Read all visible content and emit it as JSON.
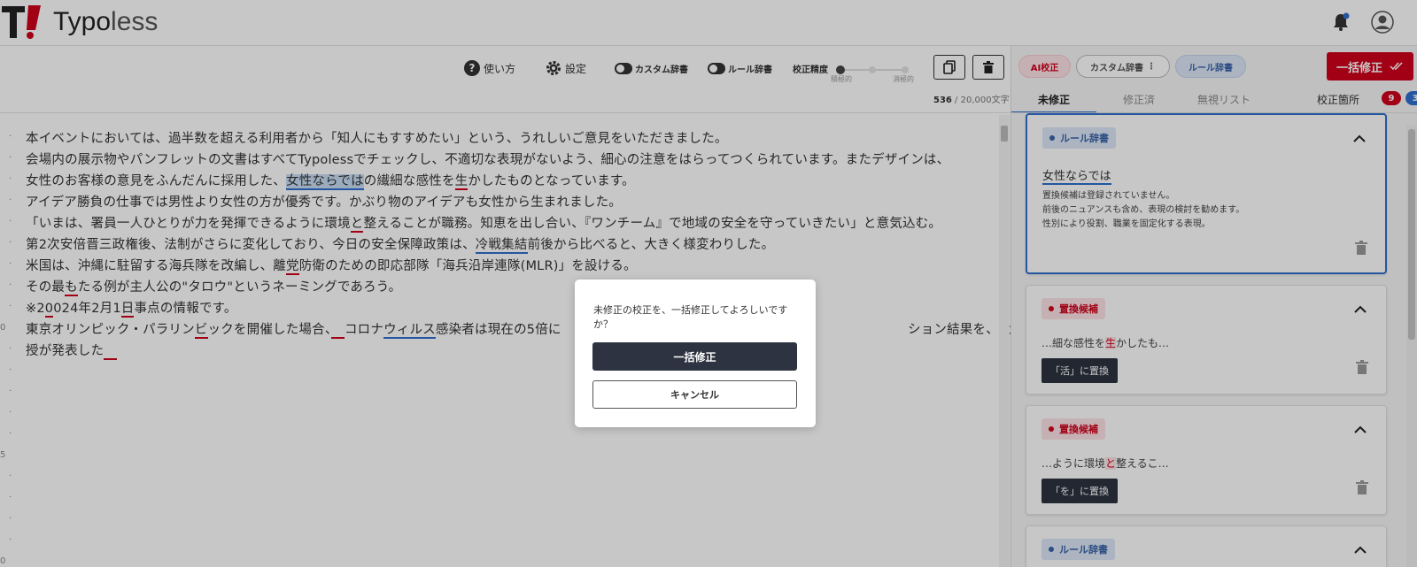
{
  "app": {
    "name_main": "Typo",
    "name_sub": "less"
  },
  "toolbar": {
    "help_label": "使い方",
    "settings_label": "設定",
    "custom_dict_label": "カスタム辞書",
    "rule_dict_label": "ルール辞書",
    "accuracy_label": "校正精度",
    "accuracy_left": "積極的",
    "accuracy_right": "消極的",
    "char_count": "536",
    "char_total": " / 20,000文字"
  },
  "editor": {
    "gutter": [
      "·",
      "·",
      "·",
      "·",
      "·",
      "·",
      "·",
      "·",
      "·",
      "0",
      "·",
      "·",
      "·",
      "·",
      "·",
      "5",
      "·",
      "·",
      "·",
      "·",
      "0"
    ],
    "lines": [
      {
        "segments": [
          {
            "t": "本イベントにおいては、過半数を超える利用者から「知人にもすすめたい」という、うれしいご意見をいただきました。"
          }
        ]
      },
      {
        "segments": [
          {
            "t": "会場内の展示物やパンフレットの文書はすべてTypolessでチェックし、不適切な表現がないよう、細心の注意をはらってつくられています。またデザインは、"
          }
        ]
      },
      {
        "segments": [
          {
            "t": "女性のお客様の意見をふんだんに採用した、"
          },
          {
            "t": "女性ならでは",
            "c": "hl"
          },
          {
            "t": "の繊細な感性を"
          },
          {
            "t": "生",
            "c": "ul-red"
          },
          {
            "t": "かしたものとなっています。"
          }
        ]
      },
      {
        "segments": [
          {
            "t": "アイデア勝負の仕事では男性より女性の方が優秀です。かぶり物のアイデアも女性から生まれました。"
          }
        ]
      },
      {
        "segments": [
          {
            "t": "「いまは、署員一人ひとりが力を発揮できるように環境"
          },
          {
            "t": "と",
            "c": "ul-red"
          },
          {
            "t": "整えることが職務。知恵を出し合い、『ワンチーム』で地域の安全を守っていきたい」と意気込む。"
          }
        ]
      },
      {
        "segments": [
          {
            "t": "第2次安倍晋三政権後、法制がさらに変化しており、今日の安全保障政策は、"
          },
          {
            "t": "冷戦集結",
            "c": "ul-blue"
          },
          {
            "t": "前後から比べると、大きく様変わりした。"
          }
        ]
      },
      {
        "segments": [
          {
            "t": "米国は、沖縄に駐留する海兵隊を改編し、離"
          },
          {
            "t": "党",
            "c": "ul-red"
          },
          {
            "t": "防衛のための即応部隊「海兵沿岸連隊(MLR)」を設ける。"
          }
        ]
      },
      {
        "segments": [
          {
            "t": "その最"
          },
          {
            "t": "も",
            "c": "ul-red"
          },
          {
            "t": "たる例が主人公の\"タロウ\"というネーミングであろう。"
          }
        ]
      },
      {
        "segments": [
          {
            "t": "※2"
          },
          {
            "t": "0",
            "c": "ul-red"
          },
          {
            "t": "024年2月1"
          },
          {
            "t": "日",
            "c": "ul-red"
          },
          {
            "t": "事点の情報です。"
          }
        ]
      },
      {
        "segments": [
          {
            "t": "東京オリンピック・パラリン"
          },
          {
            "t": "ビ",
            "c": "ul-red"
          },
          {
            "t": "ックを開催した場合、"
          },
          {
            "t": "　",
            "c": "ul-red"
          },
          {
            "t": "コロナ"
          },
          {
            "t": "ウィルス",
            "c": "ul-blue"
          },
          {
            "t": "感染者は現在の5倍に"
          }
        ]
      },
      {
        "segments": [
          {
            "t": "ション結果を、A大学のB教"
          }
        ]
      },
      {
        "segments": [
          {
            "t": "授が発表した"
          },
          {
            "t": "　",
            "c": "ul-red"
          }
        ]
      }
    ]
  },
  "panel": {
    "chip_ai": "AI校正",
    "chip_custom": "カスタム辞書",
    "chip_custom_more": "⋮",
    "chip_rule": "ルール辞書",
    "fix_all_label": "一括修正",
    "tabs": [
      "未修正",
      "修正済",
      "無視リスト"
    ],
    "count_label": "校正箇所",
    "count_red": "9",
    "count_blue": "3",
    "cards": [
      {
        "tag": "ルール辞書",
        "word": "女性ならでは",
        "desc": [
          "置換候補は登録されていません。",
          "前後のニュアンスも含め、表現の検討を勧めます。",
          "性別により役割、職業を固定化する表現。"
        ]
      },
      {
        "tag": "置換候補",
        "snippet_pre": "…細な感性を",
        "snippet_hl": "生",
        "snippet_post": "かしたも…",
        "button": "「活」に置換"
      },
      {
        "tag": "置換候補",
        "snippet_pre": "…ように環境",
        "snippet_hl": "と",
        "snippet_post": "整えるこ…",
        "button": "「を」に置換"
      },
      {
        "tag": "ルール辞書"
      }
    ]
  },
  "modal": {
    "message": "未修正の校正を、一括修正してよろしいですか？",
    "confirm_label": "一括修正",
    "cancel_label": "キャンセル"
  },
  "colors": {
    "accent_red": "#d0021b",
    "accent_blue": "#2f6fd0",
    "dark_button": "#2d3340"
  }
}
